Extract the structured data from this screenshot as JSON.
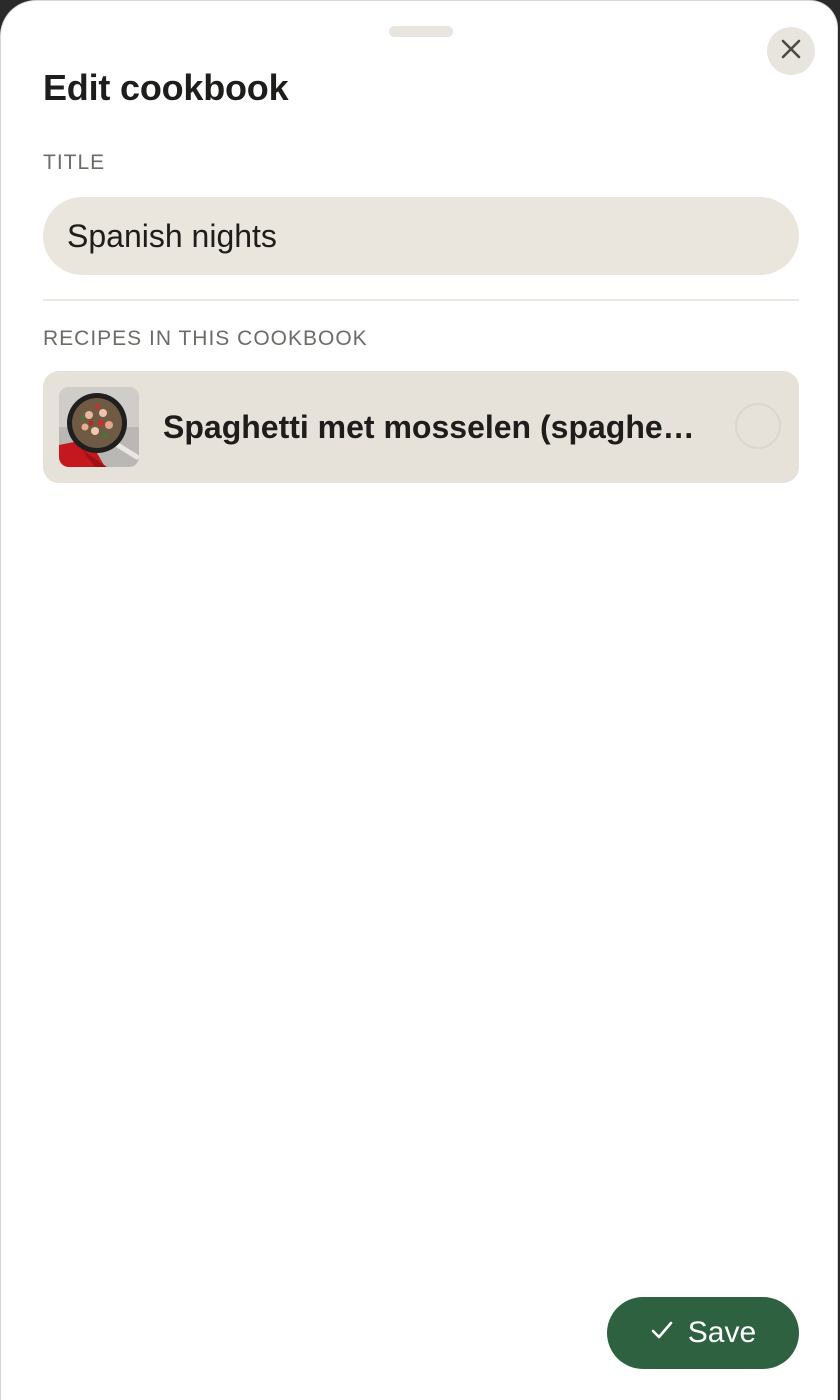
{
  "sheet": {
    "title": "Edit cookbook",
    "close_icon": "close-icon",
    "grabber_icon": "drag-handle"
  },
  "title_field": {
    "label": "TITLE",
    "value": "Spanish nights"
  },
  "recipes_section": {
    "label": "RECIPES IN THIS COOKBOOK",
    "items": [
      {
        "name": "Spaghetti met mosselen (spaghe…",
        "thumbnail": "recipe-thumbnail-pasta-pan",
        "selected": false
      }
    ]
  },
  "actions": {
    "save_label": "Save",
    "save_icon": "checkmark-icon"
  },
  "colors": {
    "accent": "#2d6140",
    "field_bg": "#ebe6dd",
    "row_bg": "#e6e1d9",
    "text": "#1d1d1b",
    "muted": "#6c6b66"
  }
}
